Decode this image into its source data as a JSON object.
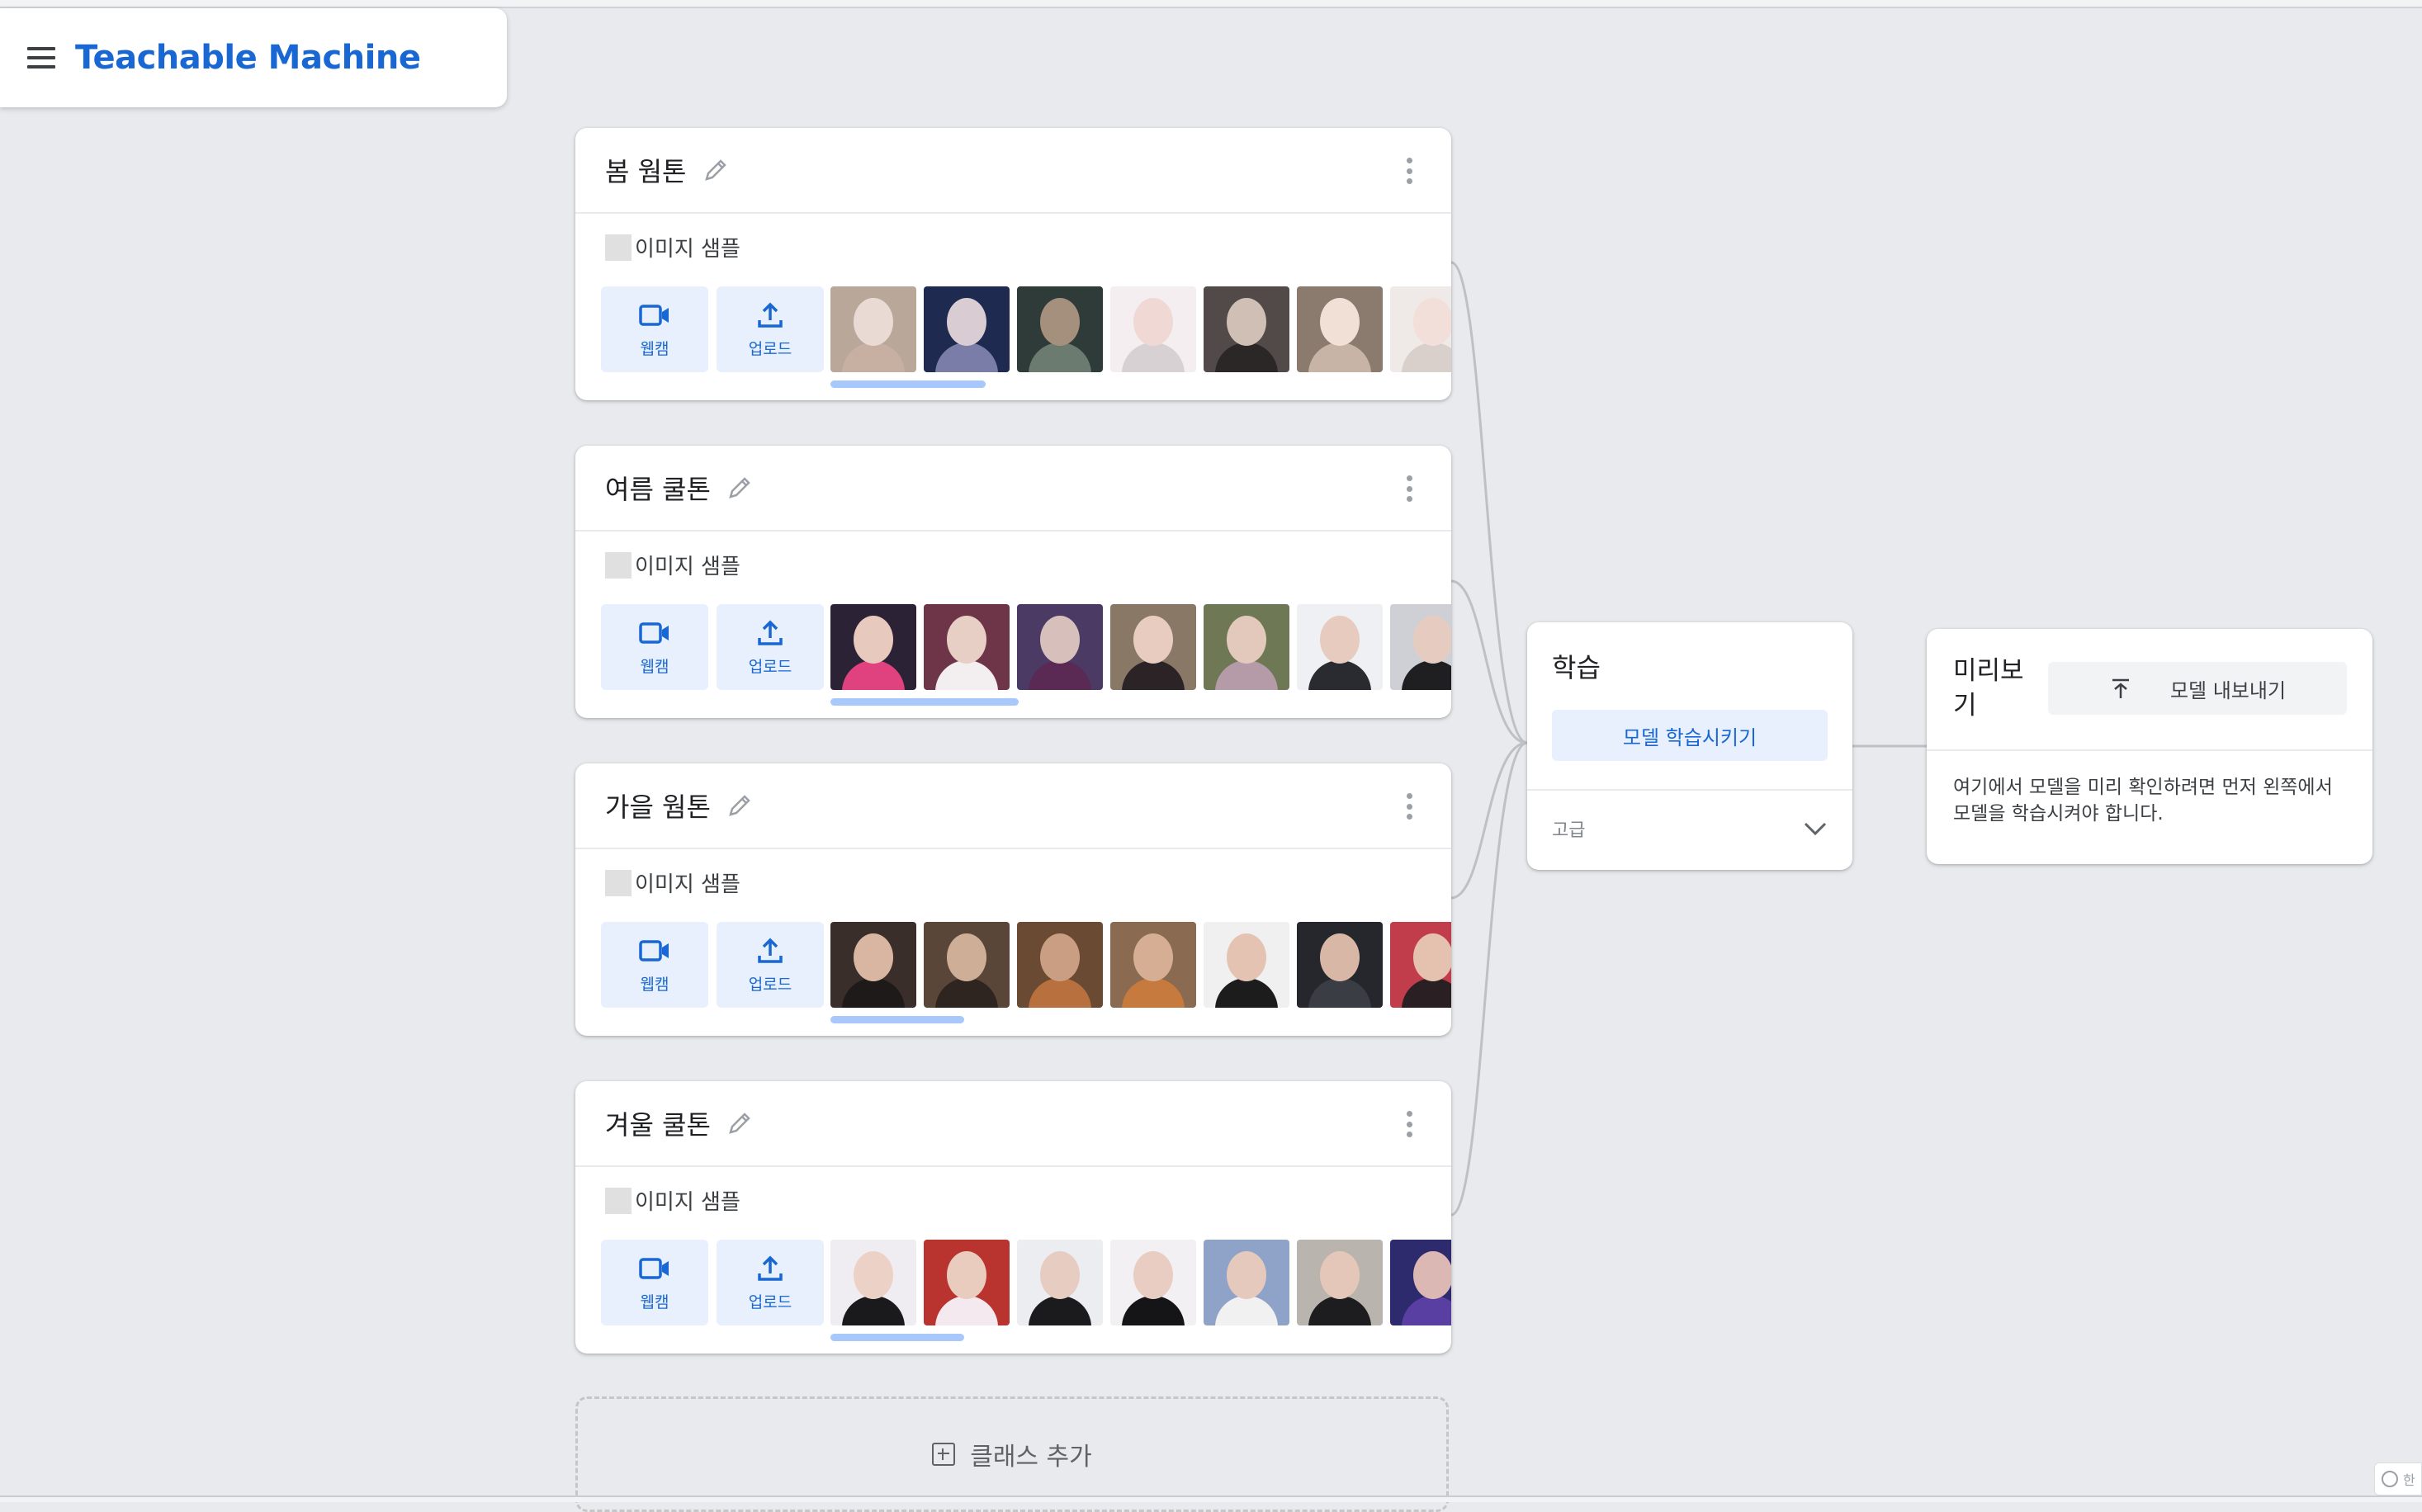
{
  "app": {
    "title": "Teachable Machine"
  },
  "classes": [
    {
      "name": "봄 웜톤",
      "sample_label": "이미지 샘플",
      "webcam_label": "웹캠",
      "upload_label": "업로드",
      "thumb_colors": [
        [
          "#b9a79a",
          "#e9dbd3",
          "#c7b0a2"
        ],
        [
          "#1e2a50",
          "#d9cdd3",
          "#7a7da8"
        ],
        [
          "#2f3b39",
          "#a58f7d",
          "#6b7b6f"
        ],
        [
          "#f4eef0",
          "#f0d9d4",
          "#d7d1d4"
        ],
        [
          "#514a48",
          "#cfbfb4",
          "#2a2726"
        ],
        [
          "#8b7a6e",
          "#f0e0d6",
          "#c8b4a6"
        ],
        [
          "#efeae8",
          "#f2dfd9",
          "#d9cfcb"
        ]
      ]
    },
    {
      "name": "여름 쿨톤",
      "sample_label": "이미지 샘플",
      "webcam_label": "웹캠",
      "upload_label": "업로드",
      "thumb_colors": [
        [
          "#2b2235",
          "#e8c9bd",
          "#e0427f"
        ],
        [
          "#6e3447",
          "#e8cfc6",
          "#f3eef0"
        ],
        [
          "#4a3a64",
          "#d7bfbc",
          "#5a2a55"
        ],
        [
          "#8a7867",
          "#e7ccbf",
          "#2b2326"
        ],
        [
          "#6e7854",
          "#e3c9bc",
          "#b59aa8"
        ],
        [
          "#eef0f3",
          "#e8cbbf",
          "#2a2b30"
        ],
        [
          "#cfd0d5",
          "#e6cbc1",
          "#1f1f22"
        ]
      ]
    },
    {
      "name": "가을 웜톤",
      "sample_label": "이미지 샘플",
      "webcam_label": "웹캠",
      "upload_label": "업로드",
      "thumb_colors": [
        [
          "#3a2e2a",
          "#d9b6a2",
          "#1e1a19"
        ],
        [
          "#5a4638",
          "#cfae98",
          "#2e2520"
        ],
        [
          "#6b4a33",
          "#c99e82",
          "#b8713e"
        ],
        [
          "#8a6a50",
          "#d5ae93",
          "#c77a3e"
        ],
        [
          "#f0f0f0",
          "#e5c3b3",
          "#1c1c1c"
        ],
        [
          "#25272c",
          "#d8b7a6",
          "#3b3d44"
        ],
        [
          "#c23d4c",
          "#e5c1b0",
          "#2a1f22"
        ]
      ]
    },
    {
      "name": "겨울 쿨톤",
      "sample_label": "이미지 샘플",
      "webcam_label": "웹캠",
      "upload_label": "업로드",
      "thumb_colors": [
        [
          "#f0edf2",
          "#ecd2c6",
          "#1a1a1d"
        ],
        [
          "#b9332f",
          "#e9ccbe",
          "#f3e9ee"
        ],
        [
          "#ecedf0",
          "#e7cdc1",
          "#1b1b1e"
        ],
        [
          "#f2f0f2",
          "#e9cdc2",
          "#151517"
        ],
        [
          "#8fa2c8",
          "#e6c9bd",
          "#f1f1f1"
        ],
        [
          "#b9b4ad",
          "#e4c7b9",
          "#1d1d20"
        ],
        [
          "#2e2a6e",
          "#dcb8b4",
          "#5a3fa2"
        ]
      ]
    }
  ],
  "add_class_label": "클래스 추가",
  "training": {
    "title": "학습",
    "train_button": "모델 학습시키기",
    "advanced_label": "고급"
  },
  "preview": {
    "title": "미리보기",
    "export_button": "모델 내보내기",
    "message": "여기에서 모델을 미리 확인하려면 먼저 왼쪽에서 모델을 학습시켜야 합니다."
  },
  "lang_badge": "한",
  "colors": {
    "accent": "#1967d2",
    "accent_bg": "#e8f0fe",
    "scrollbar": "#a8c7fa",
    "background": "#e8eaed"
  }
}
